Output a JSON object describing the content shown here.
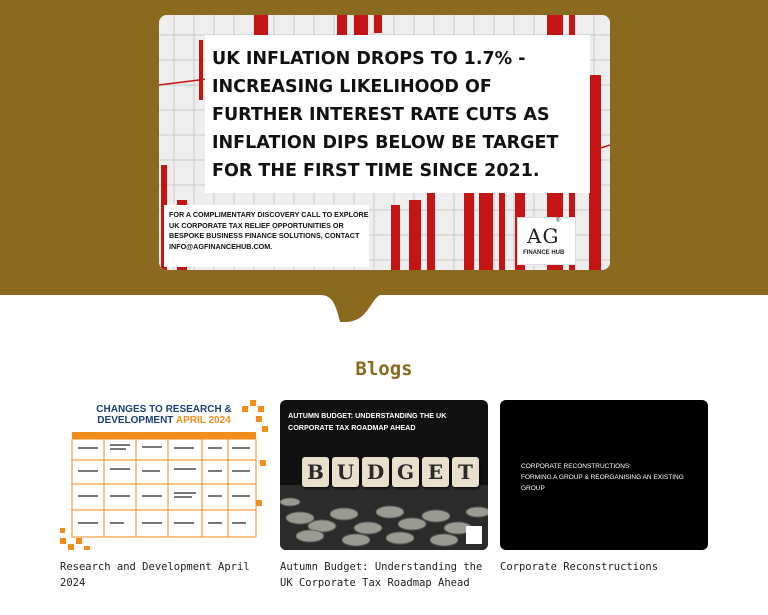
{
  "colors": {
    "band": "#8a6a1f",
    "heading": "#8a6a1f",
    "chart_red": "#c41414",
    "rd_blue": "#1c3f7a",
    "rd_orange": "#f28c1b"
  },
  "hero": {
    "headline": "UK INFLATION DROPS TO 1.7% - INCREASING LIKELIHOOD OF FURTHER INTEREST RATE CUTS AS INFLATION DIPS BELOW BE TARGET FOR THE FIRST TIME SINCE 2021.",
    "cta": "FOR A COMPLIMENTARY DISCOVERY CALL TO EXPLORE UK CORPORATE TAX RELIEF OPPORTUNITIES OR BESPOKE BUSINESS FINANCE SOLUTIONS, CONTACT INFO@AGFINANCEHUB.COM.",
    "logo": {
      "mark": "AG",
      "sub": "FINANCE HUB",
      "reg": "®"
    }
  },
  "blogs": {
    "heading": "Blogs",
    "cards": [
      {
        "title": "Research and Development April 2024",
        "thumb": {
          "line1": "CHANGES TO RESEARCH &",
          "line2": "DEVELOPMENT",
          "line2_accent": "APRIL 2024"
        }
      },
      {
        "title": "Autumn Budget: Understanding the UK Corporate Tax Roadmap Ahead",
        "thumb": {
          "caption": "AUTUMN BUDGET: UNDERSTANDING THE UK CORPORATE TAX ROADMAP AHEAD",
          "tiles": [
            "B",
            "U",
            "D",
            "G",
            "E",
            "T"
          ]
        }
      },
      {
        "title": "Corporate Reconstructions",
        "thumb": {
          "caption_line1": "CORPORATE RECONSTRUCTIONS:",
          "caption_line2": "FORMING A GROUP & REORGANISING AN EXISTING GROUP"
        }
      }
    ]
  }
}
